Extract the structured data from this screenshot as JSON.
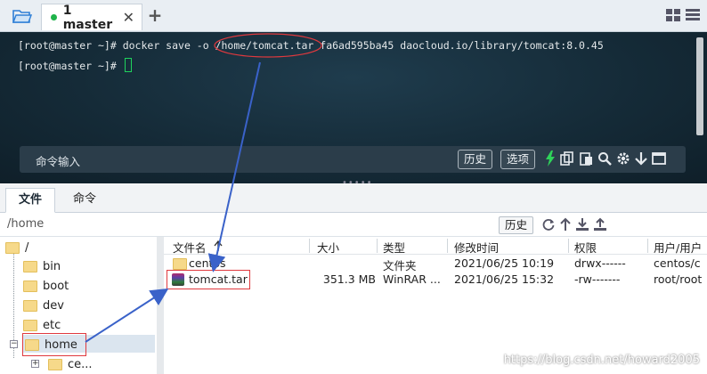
{
  "tabbar": {
    "folder_icon": "folder-open-icon",
    "tab_label": "1 master",
    "close_glyph": "✕",
    "add_glyph": "+",
    "status_color": "#1fb34a"
  },
  "terminal": {
    "line1_prompt": "[root@master ~]# ",
    "line1_cmd_a": "docker save -o ",
    "line1_path": "/home/tomcat.tar",
    "line1_cmd_b": " fa6ad595ba45 daocloud.io/library/tomcat:8.0.45",
    "line2_prompt": "[root@master ~]# ",
    "cmd_placeholder": "命令输入",
    "history_btn": "历史",
    "options_btn": "选项"
  },
  "lower_tabs": {
    "files": "文件",
    "commands": "命令"
  },
  "pathbar": {
    "path": "/home",
    "history_btn": "历史"
  },
  "tree": {
    "root": "/",
    "items": [
      "bin",
      "boot",
      "dev",
      "etc",
      "home",
      "ce..."
    ]
  },
  "filelist": {
    "columns": [
      "文件名",
      "大小",
      "类型",
      "修改时间",
      "权限",
      "用户/用户"
    ],
    "rows": [
      {
        "name": "centos",
        "size": "",
        "type": "文件夹",
        "mtime": "2021/06/25 10:19",
        "perm": "drwx------",
        "owner": "centos/c"
      },
      {
        "name": "tomcat.tar",
        "size": "351.3 MB",
        "type": "WinRAR ...",
        "mtime": "2021/06/25 15:32",
        "perm": "-rw-------",
        "owner": "root/root"
      }
    ]
  },
  "watermark": "https://blog.csdn.net/howard2005",
  "colors": {
    "annotation_red": "#e0393e",
    "annotation_blue": "#3a62c9"
  }
}
